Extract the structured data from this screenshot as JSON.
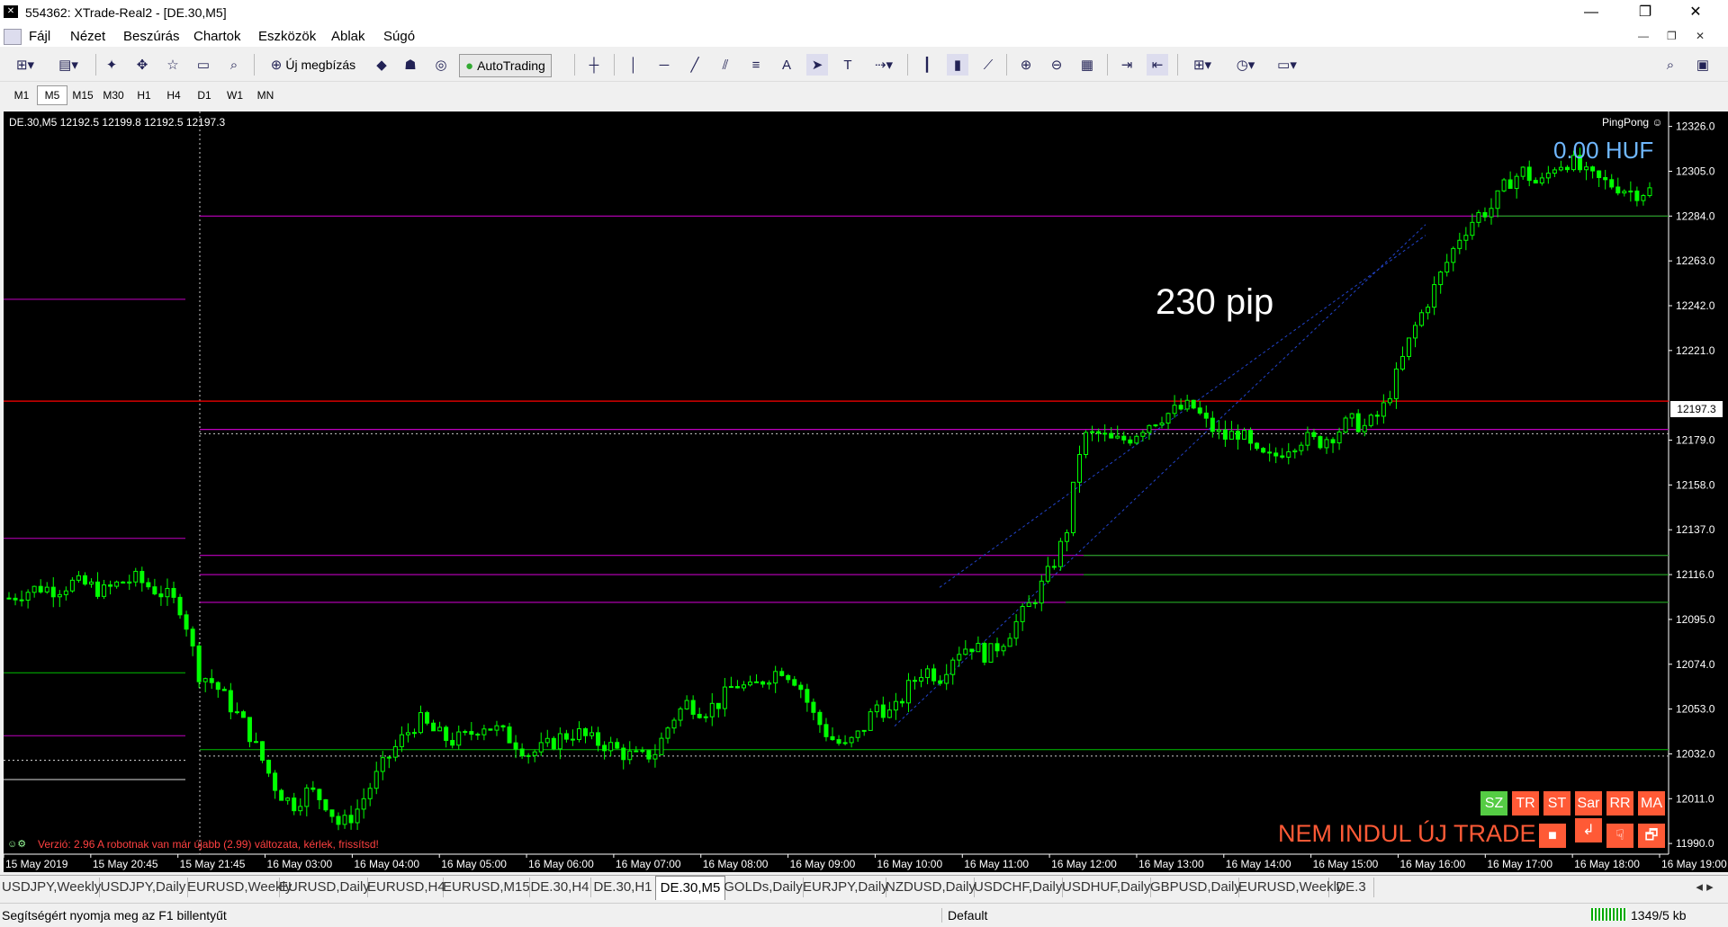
{
  "window": {
    "title": "554362: XTrade-Real2 - [DE.30,M5]",
    "minimize": "—",
    "maximize": "❐",
    "close": "✕"
  },
  "menu": [
    "Fájl",
    "Nézet",
    "Beszúrás",
    "Chartok",
    "Eszközök",
    "Ablak",
    "Súgó"
  ],
  "mdi_controls": [
    "—",
    "❐",
    "✕"
  ],
  "toolbar": {
    "new_order_label": "Új megbízás",
    "autotrading_label": "AutoTrading"
  },
  "timeframes": [
    "M1",
    "M5",
    "M15",
    "M30",
    "H1",
    "H4",
    "D1",
    "W1",
    "MN"
  ],
  "active_timeframe": "M5",
  "chart": {
    "symbol_info": "DE.30,M5  12192.5 12199.8 12192.5 12197.3",
    "ea_name": "PingPong ☺",
    "balance": "0.00 HUF",
    "annotation": "230 pip",
    "version_notice": "Verzió: 2.96  A robotnak van már újabb (2.99) változata, kérlek, frissítsd!",
    "trade_status": "NEM INDUL ÚJ TRADE",
    "current_price": "12197.3",
    "buttons_row1": [
      "SZ",
      "TR",
      "ST",
      "Sar",
      "RR",
      "MA"
    ],
    "buttons_row2": [
      "■",
      "↲",
      "☟",
      "🗗"
    ],
    "colors": {
      "background": "#000000",
      "candle": "#00ff00",
      "magenta_line": "#c000c0",
      "green_line": "#00c000",
      "red_line": "#ff0000",
      "balance_text": "#6fb7ff",
      "trade_status": "#ff5a36",
      "button_red": "#ff5a36",
      "button_green": "#55cc44"
    }
  },
  "chart_data": {
    "type": "candlestick",
    "symbol": "DE.30",
    "timeframe": "M5",
    "y_ticks": [
      "12326.0",
      "12305.0",
      "12284.0",
      "12263.0",
      "12242.0",
      "12221.0",
      "12179.0",
      "12158.0",
      "12137.0",
      "12116.0",
      "12095.0",
      "12074.0",
      "12053.0",
      "12032.0",
      "12011.0",
      "11990.0"
    ],
    "x_ticks": [
      "15 May 2019",
      "15 May 20:45",
      "15 May 21:45",
      "16 May 03:00",
      "16 May 04:00",
      "16 May 05:00",
      "16 May 06:00",
      "16 May 07:00",
      "16 May 08:00",
      "16 May 09:00",
      "16 May 10:00",
      "16 May 11:00",
      "16 May 12:00",
      "16 May 13:00",
      "16 May 14:00",
      "16 May 15:00",
      "16 May 16:00",
      "16 May 17:00",
      "16 May 18:00",
      "16 May 19:00"
    ],
    "ylim": [
      11985,
      12333
    ],
    "close_path": [
      12105,
      12108,
      12110,
      12109,
      12112,
      12111,
      12108,
      12112,
      12114,
      12110,
      12106,
      12100,
      12070,
      12065,
      12055,
      12045,
      12030,
      12015,
      12008,
      12015,
      12010,
      11998,
      12005,
      12018,
      12030,
      12040,
      12048,
      12042,
      12038,
      12040,
      12046,
      12043,
      12038,
      12032,
      12035,
      12040,
      12042,
      12038,
      12036,
      12032,
      12030,
      12033,
      12048,
      12056,
      12052,
      12056,
      12065,
      12062,
      12068,
      12072,
      12066,
      12050,
      12040,
      12035,
      12042,
      12055,
      12050,
      12063,
      12072,
      12068,
      12080,
      12083,
      12078,
      12085,
      12095,
      12105,
      12118,
      12135,
      12180,
      12182,
      12178,
      12180,
      12186,
      12190,
      12193,
      12195,
      12186,
      12180,
      12183,
      12172,
      12170,
      12176,
      12180,
      12178,
      12182,
      12188,
      12185,
      12192,
      12210,
      12230,
      12245,
      12260,
      12275,
      12284,
      12288,
      12300,
      12305,
      12298,
      12308,
      12310,
      12303,
      12300,
      12298,
      12295,
      12296
    ],
    "horizontal_lines": [
      {
        "price": 12284,
        "color": "magenta"
      },
      {
        "price": 12197.3,
        "color": "red"
      },
      {
        "price": 12184,
        "color": "magenta"
      },
      {
        "price": 12125,
        "color": "magenta"
      },
      {
        "price": 12116,
        "color": "magenta"
      },
      {
        "price": 12103,
        "color": "magenta"
      }
    ]
  },
  "tabs": [
    "USDJPY,Weekly",
    "USDJPY,Daily",
    "EURUSD,Weekly",
    "EURUSD,Daily",
    "EURUSD,H4",
    "EURUSD,M15",
    "DE.30,H4",
    "DE.30,H1",
    "DE.30,M5",
    "GOLDs,Daily",
    "EURJPY,Daily",
    "NZDUSD,Daily",
    "USDCHF,Daily",
    "USDHUF,Daily",
    "GBPUSD,Daily",
    "EURUSD,Weekly",
    "DE.3"
  ],
  "active_tab": "DE.30,M5",
  "status": {
    "help": "Segítségért nyomja meg az F1 billentyűt",
    "profile": "Default",
    "traffic": "1349/5 kb"
  }
}
